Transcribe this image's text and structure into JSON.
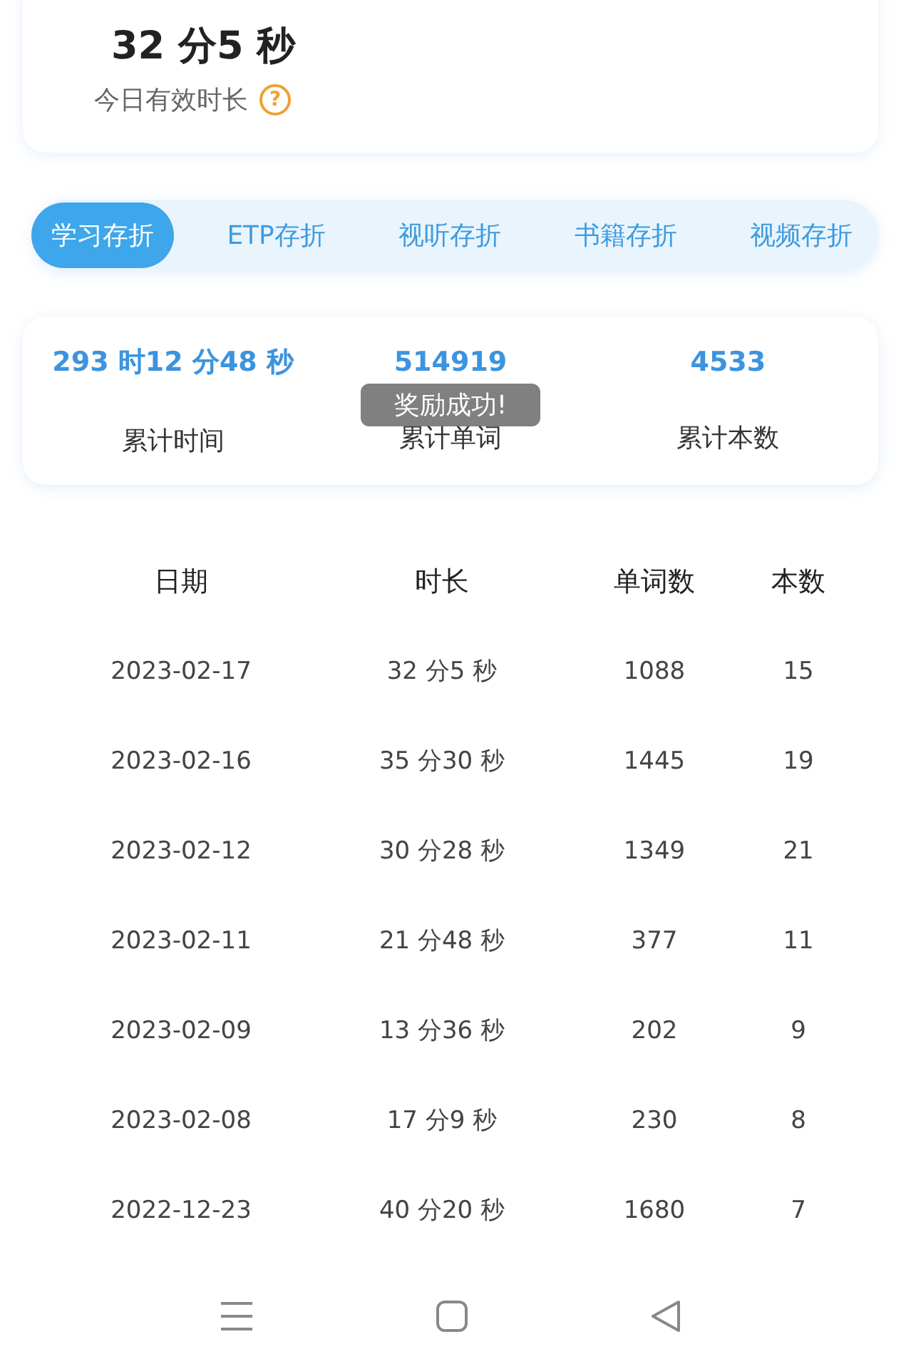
{
  "today": {
    "duration": "32 分5 秒",
    "label": "今日有效时长",
    "help_icon": "?"
  },
  "tabs": [
    {
      "label": "学习存折",
      "selected": true
    },
    {
      "label": "ETP存折",
      "selected": false
    },
    {
      "label": "视听存折",
      "selected": false
    },
    {
      "label": "书籍存折",
      "selected": false
    },
    {
      "label": "视频存折",
      "selected": false
    }
  ],
  "stats": [
    {
      "value": "293 时12 分48 秒",
      "label": "累计时间"
    },
    {
      "value": "514919",
      "label": "累计单词"
    },
    {
      "value": "4533",
      "label": "累计本数"
    }
  ],
  "toast": "奖励成功!",
  "table": {
    "columns": [
      "日期",
      "时长",
      "单词数",
      "本数"
    ],
    "rows": [
      [
        "2023-02-17",
        "32 分5 秒",
        "1088",
        "15"
      ],
      [
        "2023-02-16",
        "35 分30 秒",
        "1445",
        "19"
      ],
      [
        "2023-02-12",
        "30 分28 秒",
        "1349",
        "21"
      ],
      [
        "2023-02-11",
        "21 分48 秒",
        "377",
        "11"
      ],
      [
        "2023-02-09",
        "13 分36 秒",
        "202",
        "9"
      ],
      [
        "2023-02-08",
        "17 分9 秒",
        "230",
        "8"
      ],
      [
        "2022-12-23",
        "40 分20 秒",
        "1680",
        "7"
      ]
    ]
  }
}
